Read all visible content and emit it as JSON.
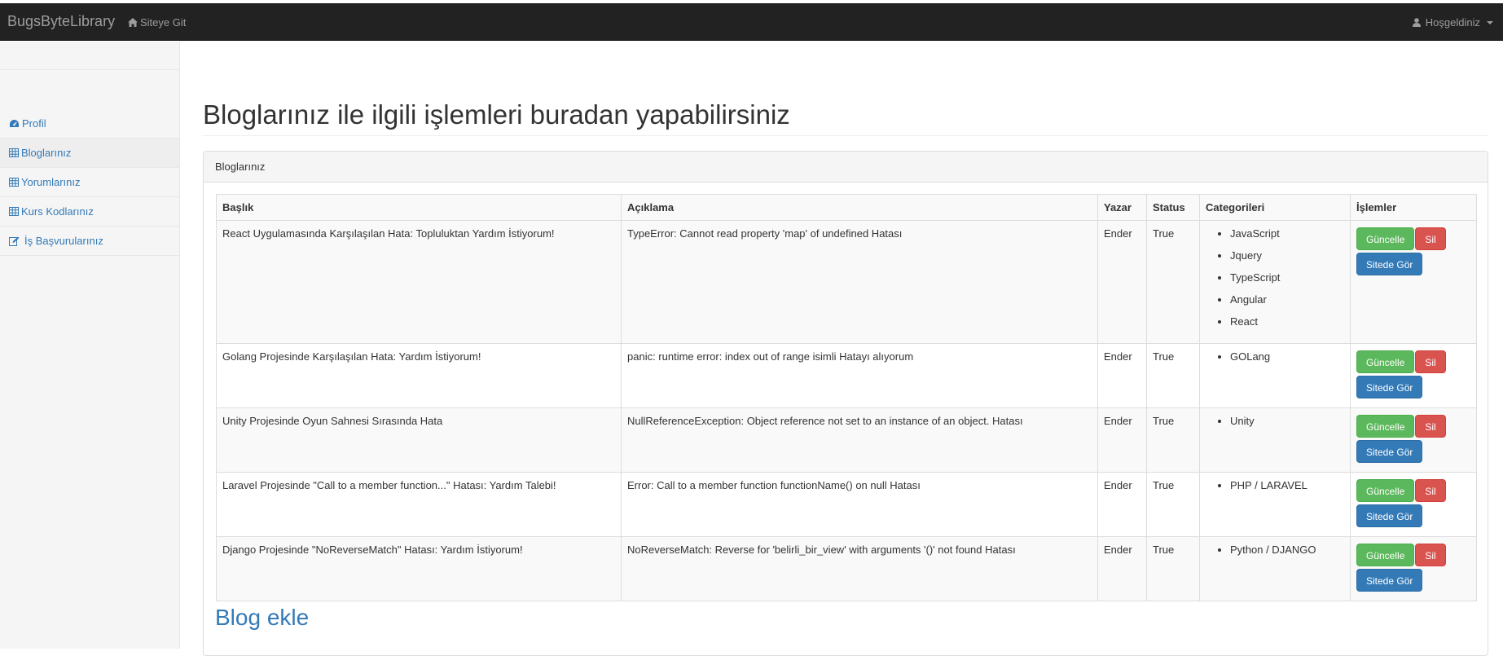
{
  "navbar": {
    "brand": "BugsByteLibrary",
    "site_link": "Siteye Git",
    "user_menu": "Hoşgeldiniz"
  },
  "sidebar": {
    "items": [
      {
        "label": "Profil",
        "icon": "dashboard-icon"
      },
      {
        "label": "Bloglarınız",
        "icon": "table-icon"
      },
      {
        "label": "Yorumlarınız",
        "icon": "table-icon"
      },
      {
        "label": "Kurs Kodlarınız",
        "icon": "table-icon"
      },
      {
        "label": "İş Başvurularınız",
        "icon": "edit-icon"
      }
    ]
  },
  "page": {
    "title": "Bloglarınız ile ilgili işlemleri buradan yapabilirsiniz",
    "panel_heading": "Bloglarınız",
    "blog_add": "Blog ekle"
  },
  "table": {
    "headers": [
      "Başlık",
      "Açıklama",
      "Yazar",
      "Status",
      "Categorileri",
      "İşlemler"
    ],
    "actions": {
      "update": "Güncelle",
      "delete": "Sil",
      "view": "Sitede Gör"
    },
    "rows": [
      {
        "title": "React Uygulamasında Karşılaşılan Hata: Topluluktan Yardım İstiyorum!",
        "description": "TypeError: Cannot read property 'map' of undefined Hatası",
        "author": "Ender",
        "status": "True",
        "categories": [
          "JavaScript",
          "Jquery",
          "TypeScript",
          "Angular",
          "React"
        ]
      },
      {
        "title": "Golang Projesinde Karşılaşılan Hata: Yardım İstiyorum!",
        "description": "panic: runtime error: index out of range isimli Hatayı alıyorum",
        "author": "Ender",
        "status": "True",
        "categories": [
          "GOLang"
        ]
      },
      {
        "title": "Unity Projesinde Oyun Sahnesi Sırasında Hata",
        "description": "NullReferenceException: Object reference not set to an instance of an object. Hatası",
        "author": "Ender",
        "status": "True",
        "categories": [
          "Unity"
        ]
      },
      {
        "title": "Laravel Projesinde \"Call to a member function...\" Hatası: Yardım Talebi!",
        "description": "Error: Call to a member function functionName() on null Hatası",
        "author": "Ender",
        "status": "True",
        "categories": [
          "PHP / LARAVEL"
        ]
      },
      {
        "title": "Django Projesinde \"NoReverseMatch\" Hatası: Yardım İstiyorum!",
        "description": "NoReverseMatch: Reverse for 'belirli_bir_view' with arguments '()' not found Hatası",
        "author": "Ender",
        "status": "True",
        "categories": [
          "Python / DJANGO"
        ]
      }
    ]
  },
  "colors": {
    "navbar_bg": "#222222",
    "link": "#337ab7",
    "success": "#5cb85c",
    "danger": "#d9534f",
    "primary": "#337ab7"
  }
}
